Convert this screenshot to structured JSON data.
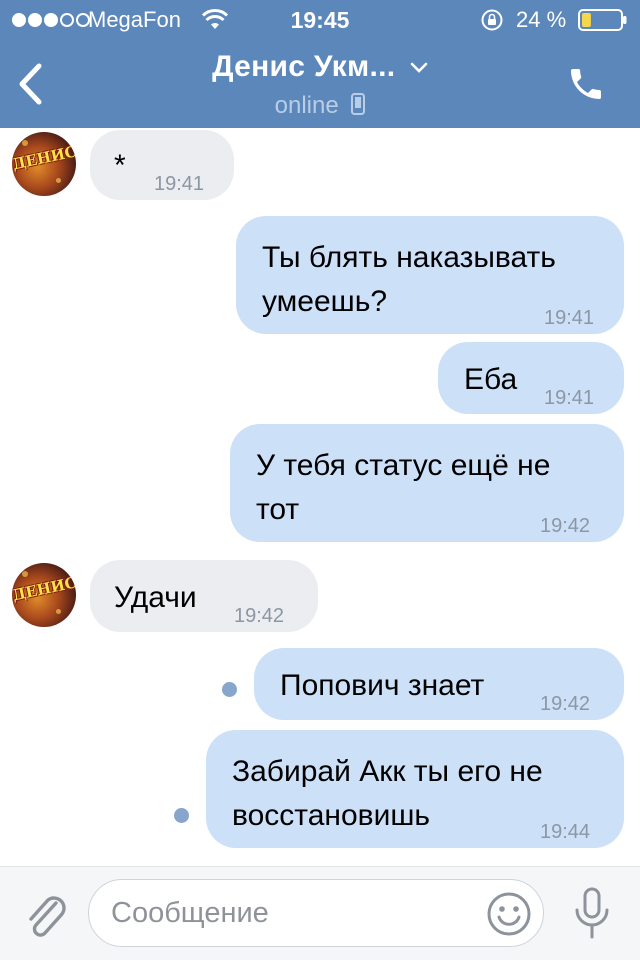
{
  "status_bar": {
    "carrier": "MegaFon",
    "time": "19:45",
    "battery": "24 %",
    "signal_bars": 3,
    "signal_total": 5,
    "battery_level": 0.24,
    "icons": [
      "wifi-icon",
      "orientation-lock-icon",
      "battery-icon"
    ]
  },
  "header": {
    "title": "Денис Укм...",
    "subtitle": "online",
    "icons": [
      "back-arrow-icon",
      "chevron-down-icon",
      "mobile-phone-icon",
      "call-icon"
    ],
    "colors": {
      "bar": "#5b87bb",
      "subtitle": "#b9cde6"
    }
  },
  "avatar": {
    "text": "ДЕНИС"
  },
  "messages": [
    {
      "direction": "in",
      "lines": [
        "*"
      ],
      "time": "19:41"
    },
    {
      "direction": "out",
      "lines": [
        "Ты блять наказывать",
        "умеешь?"
      ],
      "time": "19:41"
    },
    {
      "direction": "out",
      "lines": [
        "Еба"
      ],
      "time": "19:41"
    },
    {
      "direction": "out",
      "lines": [
        "У тебя статус ещё не",
        "тот"
      ],
      "time": "19:42"
    },
    {
      "direction": "in",
      "lines": [
        "Удачи"
      ],
      "time": "19:42"
    },
    {
      "direction": "out",
      "lines": [
        "Попович знает"
      ],
      "time": "19:42",
      "unread": true
    },
    {
      "direction": "out",
      "lines": [
        "Забирай Акк ты его не",
        "восстановишь"
      ],
      "time": "19:44",
      "unread": true
    }
  ],
  "colors": {
    "incoming_bubble": "#ebedf0",
    "outgoing_bubble": "#cce0f8",
    "time": "#8b97a4",
    "unread_dot": "#88a5cb"
  },
  "input": {
    "placeholder": "Сообщение",
    "value": "",
    "icons": [
      "paperclip-icon",
      "emoji-icon",
      "microphone-icon"
    ]
  }
}
